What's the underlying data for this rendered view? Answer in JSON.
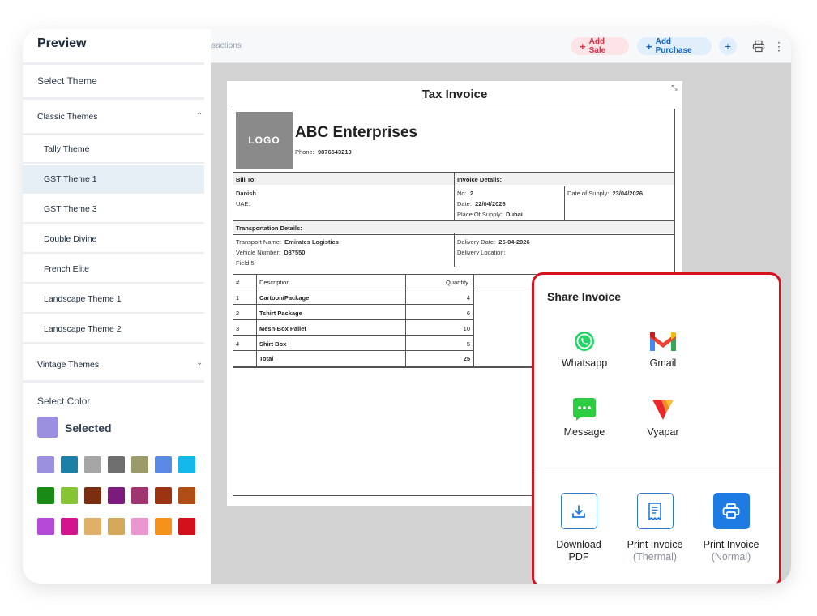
{
  "topbar": {
    "breadcrumb": "ansactions",
    "add_sale": "Add Sale",
    "add_purchase": "Add Purchase",
    "plus_icon": "plus-icon",
    "print_icon": "printer-icon",
    "more_icon": "more-vertical-icon"
  },
  "sidebar": {
    "title": "Preview",
    "select_theme": "Select Theme",
    "classic_group": "Classic Themes",
    "classic_items": [
      "Tally Theme",
      "GST Theme 1",
      "GST Theme 3",
      "Double Divine",
      "French Elite",
      "Landscape Theme 1",
      "Landscape Theme 2"
    ],
    "active_item": "GST Theme 1",
    "vintage_group": "Vintage Themes",
    "select_color": "Select Color",
    "selected_label": "Selected",
    "selected_color": "#9b8fe0",
    "swatches": [
      [
        "#9b8fe0",
        "#1c7fa6",
        "#a6a6a6",
        "#6e6e6e",
        "#9a9a6a",
        "#5b8ae6",
        "#13b8e8"
      ],
      [
        "#1a8a16",
        "#86c433",
        "#7a2e10",
        "#7d1a7d",
        "#9e3470",
        "#9c3414",
        "#b04d17"
      ],
      [
        "#b44ad6",
        "#d4138f",
        "#e0b06a",
        "#d6a85a",
        "#ea97d1",
        "#f4921c",
        "#d1101c"
      ]
    ]
  },
  "invoice": {
    "title": "Tax Invoice",
    "logo": "LOGO",
    "company": "ABC Enterprises",
    "phone_label": "Phone:",
    "phone": "9876543210",
    "bill_to": "Bill To:",
    "invoice_details": "Invoice Details:",
    "customer_name": "Danish",
    "customer_country": "UAE.",
    "no_label": "No:",
    "no": "2",
    "date_label": "Date:",
    "date": "22/04/2026",
    "place_label": "Place Of Supply:",
    "place": "Dubai",
    "supply_date_label": "Date of Supply:",
    "supply_date": "23/04/2026",
    "transport_head": "Transportation Details:",
    "transport_name_label": "Transport Name:",
    "transport_name": "Emirates Logistics",
    "vehicle_label": "Vehicle Number:",
    "vehicle": "D87550",
    "field5_label": "Field 5:",
    "delivery_date_label": "Delivery Date:",
    "delivery_date": "25-04-2026",
    "delivery_location_label": "Delivery Location:",
    "columns": [
      "#",
      "Description",
      "Quantity"
    ],
    "items": [
      {
        "no": "1",
        "desc": "Cartoon/Package",
        "qty": "4"
      },
      {
        "no": "2",
        "desc": "Tshirt Package",
        "qty": "6"
      },
      {
        "no": "3",
        "desc": "Mesh-Box Pallet",
        "qty": "10"
      },
      {
        "no": "4",
        "desc": "Shirt Box",
        "qty": "5"
      }
    ],
    "total_label": "Total",
    "total_qty": "25"
  },
  "share": {
    "title": "Share Invoice",
    "apps": [
      {
        "label": "Whatsapp",
        "icon": "whatsapp-icon",
        "color": "#25d366"
      },
      {
        "label": "Gmail",
        "icon": "gmail-icon",
        "color": "#ea4335"
      },
      {
        "label": "Message",
        "icon": "message-icon",
        "color": "#2ecc40"
      },
      {
        "label": "Vyapar",
        "icon": "vyapar-icon",
        "color": "#e8262b"
      }
    ],
    "actions": [
      {
        "label": "Download",
        "sub": "PDF",
        "icon": "download-icon"
      },
      {
        "label": "Print Invoice",
        "sub": "(Thermal)",
        "icon": "receipt-icon"
      },
      {
        "label": "Print Invoice",
        "sub": "(Normal)",
        "icon": "printer-icon"
      }
    ],
    "accent": "#1e7be3",
    "border_color": "#d7121f"
  }
}
